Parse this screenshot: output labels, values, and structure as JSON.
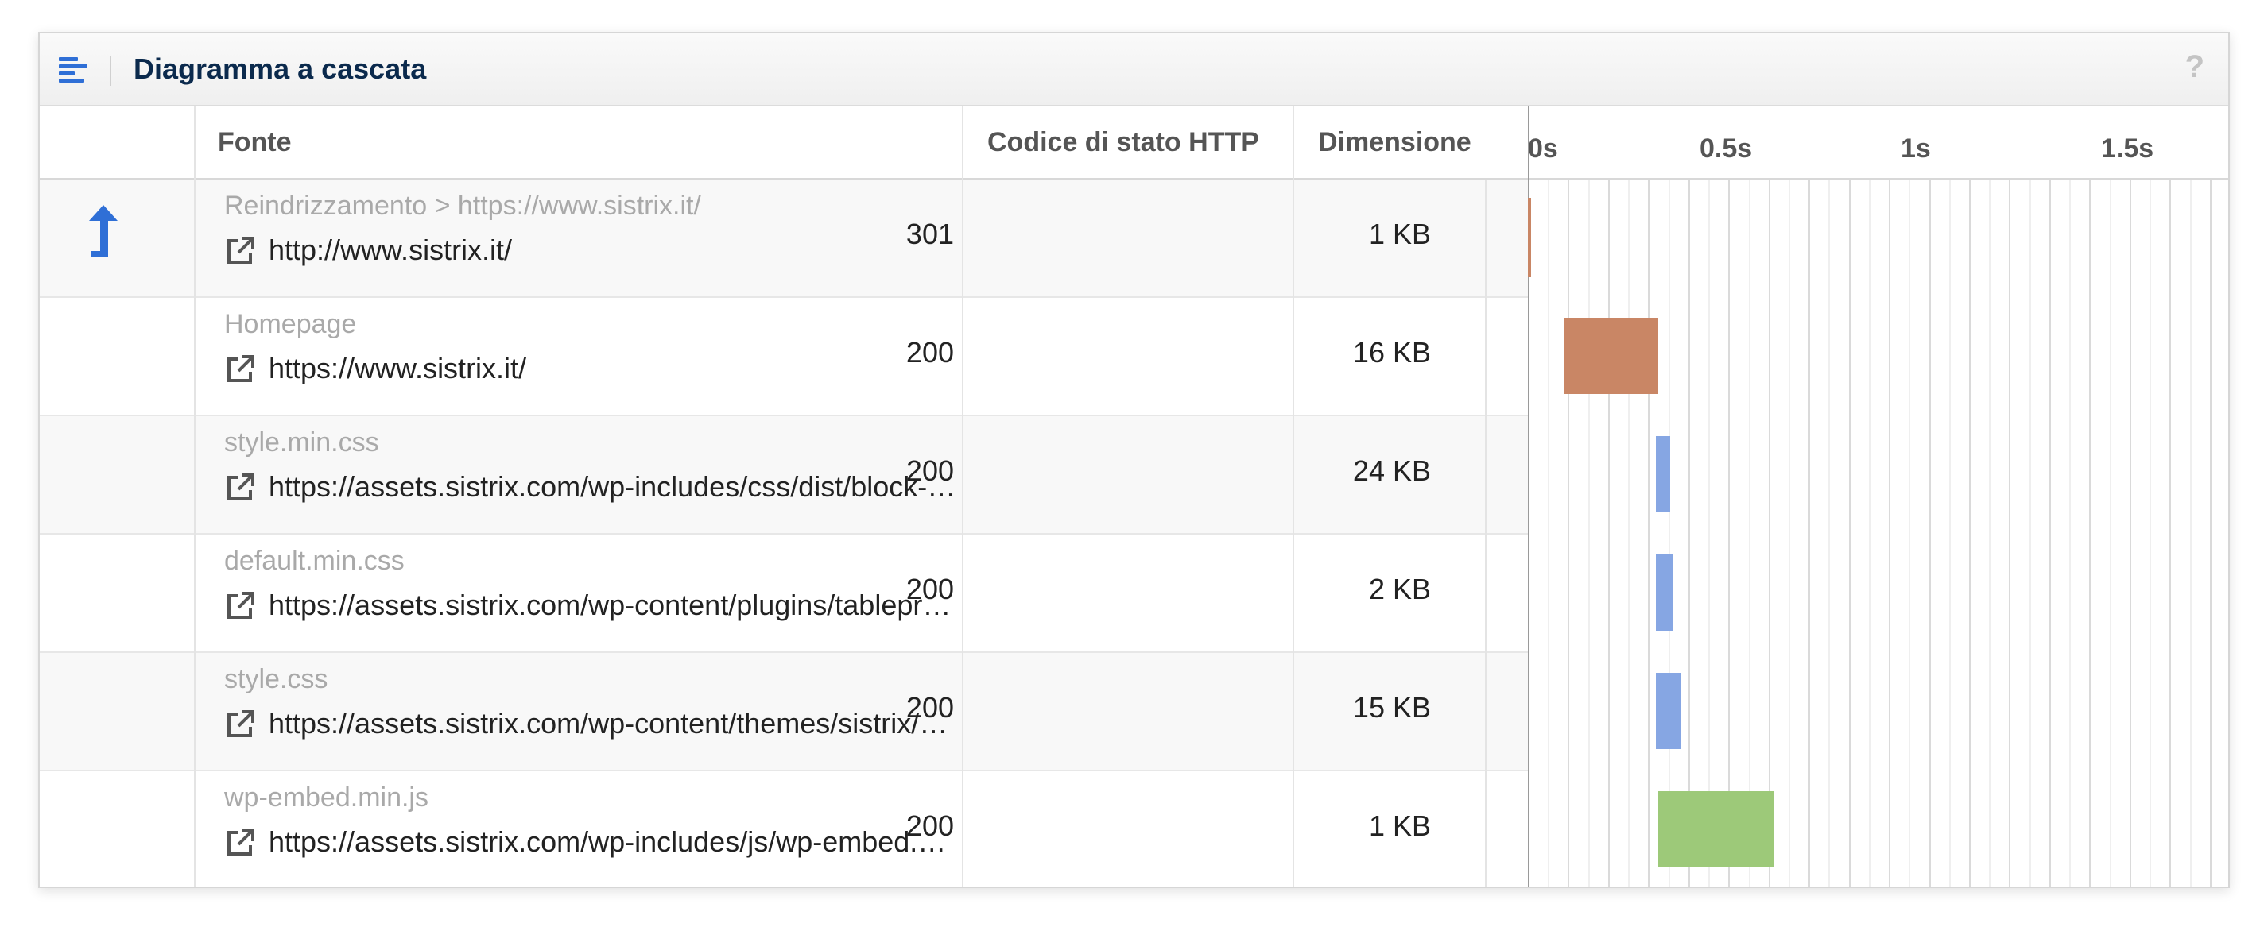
{
  "panel": {
    "title": "Diagramma a cascata",
    "help": "?"
  },
  "columns": {
    "source": "Fonte",
    "status": "Codice di stato HTTP",
    "size": "Dimensione"
  },
  "timeline": {
    "ticks": [
      "0s",
      "0.5s",
      "1s",
      "1.5s"
    ],
    "tick_values": [
      0,
      0.5,
      1,
      1.5
    ],
    "max": 1.75,
    "colors": {
      "redirect": "#c98665",
      "html": "#c98665",
      "css": "#86a6e3",
      "js": "#9dc979"
    }
  },
  "rows": [
    {
      "label": "Reindrizzamento > https://www.sistrix.it/",
      "url": "http://www.sistrix.it/",
      "status": "301",
      "size": "1 KB",
      "redirect": true,
      "type": "redirect",
      "start": 0.0,
      "end": 0.008
    },
    {
      "label": "Homepage",
      "url": "https://www.sistrix.it/",
      "status": "200",
      "size": "16 KB",
      "redirect": false,
      "type": "html",
      "start": 0.09,
      "end": 0.325
    },
    {
      "label": "style.min.css",
      "url": "https://assets.sistrix.com/wp-includes/css/dist/block-library/style.min.css",
      "status": "200",
      "size": "24 KB",
      "redirect": false,
      "type": "css",
      "start": 0.32,
      "end": 0.356
    },
    {
      "label": "default.min.css",
      "url": "https://assets.sistrix.com/wp-content/plugins/tablepress/css/default.min.css",
      "status": "200",
      "size": "2 KB",
      "redirect": false,
      "type": "css",
      "start": 0.32,
      "end": 0.363
    },
    {
      "label": "style.css",
      "url": "https://assets.sistrix.com/wp-content/themes/sistrix/style.css",
      "status": "200",
      "size": "15 KB",
      "redirect": false,
      "type": "css",
      "start": 0.32,
      "end": 0.381
    },
    {
      "label": "wp-embed.min.js",
      "url": "https://assets.sistrix.com/wp-includes/js/wp-embed.min.js",
      "status": "200",
      "size": "1 KB",
      "redirect": false,
      "type": "js",
      "start": 0.325,
      "end": 0.615
    }
  ]
}
